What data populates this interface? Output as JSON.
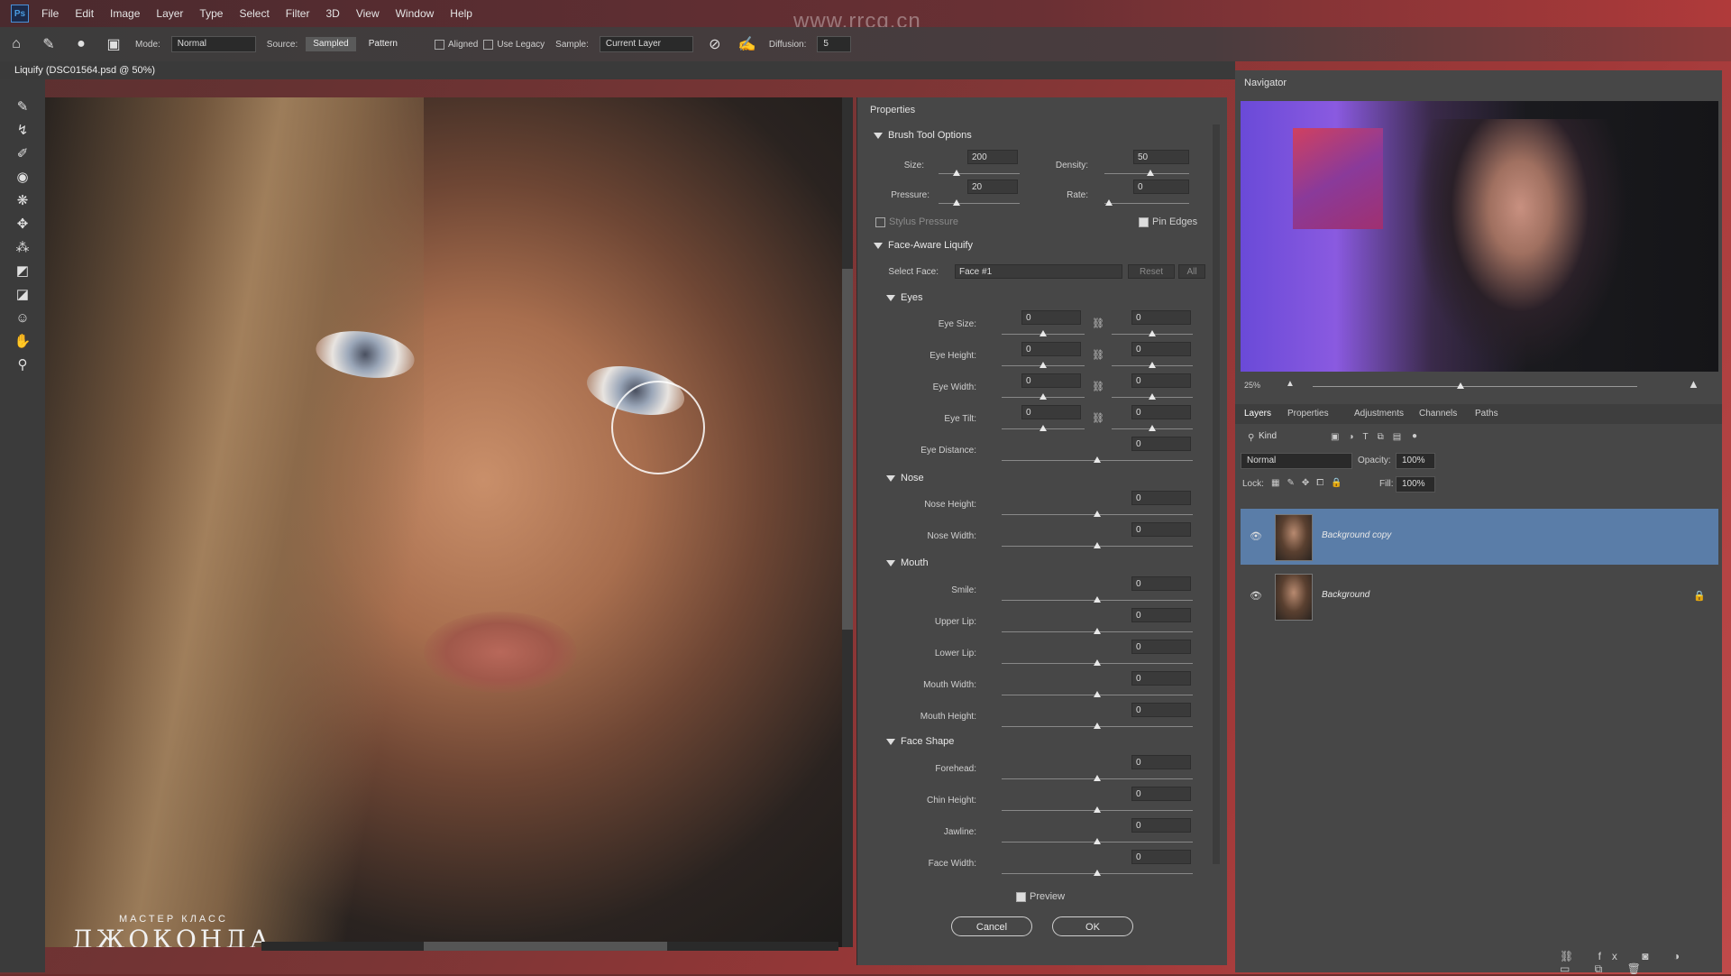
{
  "menu": [
    "File",
    "Edit",
    "Image",
    "Layer",
    "Type",
    "Select",
    "Filter",
    "3D",
    "View",
    "Window",
    "Help"
  ],
  "watermark": "www.rrcg.cn",
  "options": {
    "mode_label": "Mode:",
    "mode_value": "Normal",
    "source_label": "Source:",
    "sampled": "Sampled",
    "pattern": "Pattern",
    "aligned": "Aligned",
    "use_legacy": "Use Legacy",
    "sample_label": "Sample:",
    "sample_value": "Current Layer",
    "diffusion_label": "Diffusion:",
    "diffusion_value": "5"
  },
  "document": {
    "title": "Liquify (DSC01564.psd @ 50%)",
    "overlay_small": "МАСТЕР КЛАСС",
    "overlay_big": "ДЖОКОНДА"
  },
  "properties": {
    "title": "Properties",
    "brush_tool_options": "Brush Tool Options",
    "size_label": "Size:",
    "size_value": "200",
    "density_label": "Density:",
    "density_value": "50",
    "pressure_label": "Pressure:",
    "pressure_value": "20",
    "rate_label": "Rate:",
    "rate_value": "0",
    "stylus_pressure": "Stylus Pressure",
    "pin_edges": "Pin Edges",
    "face_aware": "Face-Aware Liquify",
    "select_face_label": "Select Face:",
    "select_face_value": "Face #1",
    "reset": "Reset",
    "all": "All",
    "eyes": "Eyes",
    "eye_size": "Eye Size:",
    "eye_height": "Eye Height:",
    "eye_width": "Eye Width:",
    "eye_tilt": "Eye Tilt:",
    "eye_distance": "Eye Distance:",
    "nose": "Nose",
    "nose_height": "Nose Height:",
    "nose_width": "Nose Width:",
    "mouth": "Mouth",
    "smile": "Smile:",
    "upper_lip": "Upper Lip:",
    "lower_lip": "Lower Lip:",
    "mouth_width": "Mouth Width:",
    "mouth_height": "Mouth Height:",
    "face_shape": "Face Shape",
    "forehead": "Forehead:",
    "chin_height": "Chin Height:",
    "jawline": "Jawline:",
    "face_width": "Face Width:",
    "zero": "0",
    "preview": "Preview",
    "cancel": "Cancel",
    "ok": "OK"
  },
  "navigator": {
    "title": "Navigator",
    "zoom": "25%"
  },
  "layers_panel": {
    "tabs": [
      "Layers",
      "Properties",
      "Adjustments",
      "Channels",
      "Paths"
    ],
    "kind": "Kind",
    "blend": "Normal",
    "opacity_label": "Opacity:",
    "opacity_value": "100%",
    "lock_label": "Lock:",
    "fill_label": "Fill:",
    "fill_value": "100%",
    "layers": [
      {
        "name": "Background copy"
      },
      {
        "name": "Background"
      }
    ]
  },
  "colors": {
    "selected_layer": "#5a7da8",
    "panel": "#474747"
  }
}
